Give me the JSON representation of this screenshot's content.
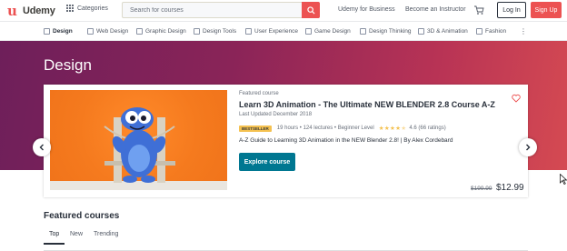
{
  "topbar": {
    "logo_text": "Udemy",
    "logo_icon": "udemy-logo-icon",
    "categories_label": "Categories",
    "search_placeholder": "Search for courses",
    "udemy_for_business": "Udemy for Business",
    "become_instructor": "Become an Instructor",
    "cart_icon": "cart-icon",
    "login_label": "Log In",
    "signup_label": "Sign Up"
  },
  "category_nav": {
    "items": [
      {
        "label": "Design",
        "icon": "design-icon"
      },
      {
        "label": "Web Design",
        "icon": "web-design-icon"
      },
      {
        "label": "Graphic Design",
        "icon": "graphic-design-icon"
      },
      {
        "label": "Design Tools",
        "icon": "design-tools-icon"
      },
      {
        "label": "User Experience",
        "icon": "user-experience-icon"
      },
      {
        "label": "Game Design",
        "icon": "game-design-icon"
      },
      {
        "label": "Design Thinking",
        "icon": "design-thinking-icon"
      },
      {
        "label": "3D & Animation",
        "icon": "3d-animation-icon"
      },
      {
        "label": "Fashion",
        "icon": "fashion-icon"
      }
    ],
    "more_icon": "more-vertical-icon"
  },
  "hero": {
    "title": "Design"
  },
  "featured_card": {
    "label": "Featured course",
    "title": "Learn 3D Animation - The Ultimate NEW BLENDER 2.8 Course A-Z",
    "updated": "Last Updated December 2018",
    "badge": "BESTSELLER",
    "hours": "19 hours",
    "lectures": "124 lectures",
    "level": "Beginner Level",
    "rating_value": 4.6,
    "rating_text": "4.6 (66 ratings)",
    "description": "A-Z Guide to Learning 3D Animation in the NEW Blender 2.8! | By Alex Cordebard",
    "cta_label": "Explore course",
    "old_price": "$199.99",
    "new_price": "$12.99"
  },
  "featured_section": {
    "title": "Featured courses",
    "tabs": [
      "Top",
      "New",
      "Trending"
    ],
    "active_tab": "Top"
  },
  "colors": {
    "brand": "#ec5252",
    "cta": "#007791",
    "star": "#f4c150",
    "hero_start": "#6e1f5a",
    "hero_end": "#d54a52"
  }
}
